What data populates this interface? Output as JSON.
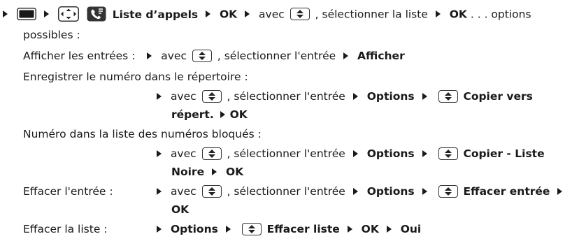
{
  "step1": {
    "call_list": "Liste d’appels",
    "ok": "OK",
    "avec": "avec",
    "select_list": ", sélectionner la liste",
    "ok2": "OK",
    "options_possibles_a": " . . . options",
    "options_possibles_b": "possibles :"
  },
  "afficher": {
    "label": "Afficher les entrées :",
    "avec": "avec",
    "select_entry": ", sélectionner l'entrée",
    "action": "Afficher"
  },
  "enregistrer": {
    "label": "Enregistrer le numéro dans le répertoire :",
    "avec": "avec",
    "select_entry": ", sélectionner l'entrée",
    "options": "Options",
    "copy_a": "Copier vers",
    "copy_b": "répert.",
    "ok": "OK"
  },
  "bloques": {
    "label": "Numéro dans la liste des numéros bloqués :",
    "avec": "avec",
    "select_entry": ", sélectionner l'entrée",
    "options": "Options",
    "copy_a": "Copier - Liste",
    "copy_b": "Noire",
    "ok": "OK"
  },
  "effacer_entree": {
    "label": "Effacer l'entrée :",
    "avec": "avec",
    "select_entry": ", sélectionner l'entrée",
    "options": "Options",
    "action": "Effacer entrée",
    "ok": "OK"
  },
  "effacer_liste": {
    "label": "Effacer la liste :",
    "options": "Options",
    "action": "Effacer liste",
    "ok": "OK",
    "oui": "Oui"
  },
  "icons": [
    "menu-key-icon",
    "nav-key-icon",
    "call-list-icon",
    "up-down-key-icon",
    "step-arrow-icon"
  ]
}
